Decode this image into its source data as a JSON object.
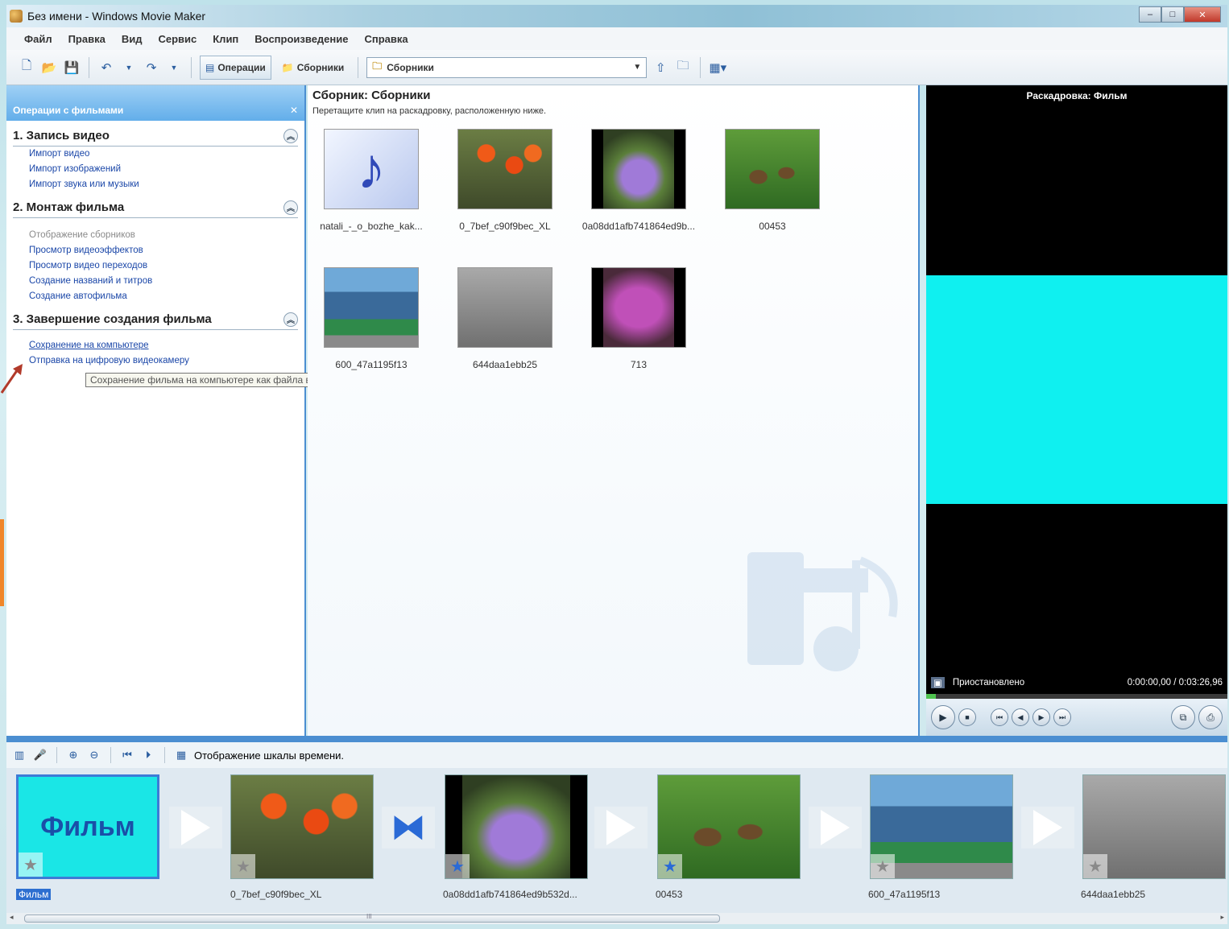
{
  "window": {
    "title": "Без имени - Windows Movie Maker"
  },
  "menu": [
    "Файл",
    "Правка",
    "Вид",
    "Сервис",
    "Клип",
    "Воспроизведение",
    "Справка"
  ],
  "toolbar": {
    "operations_label": "Операции",
    "collections_label": "Сборники",
    "collections_select": "Сборники"
  },
  "tasks": {
    "header": "Операции с фильмами",
    "sections": [
      {
        "title": "1. Запись видео",
        "links": [
          "Импорт видео",
          "Импорт изображений",
          "Импорт звука или музыки"
        ]
      },
      {
        "title": "2. Монтаж фильма",
        "links": [
          "Отображение сборников",
          "Просмотр видеоэффектов",
          "Просмотр видео переходов",
          "Создание названий и титров",
          "Создание автофильма"
        ]
      },
      {
        "title": "3. Завершение создания фильма",
        "links": [
          "Сохранение на компьютере",
          "Отправка на цифровую видеокамеру"
        ]
      }
    ],
    "tooltip": "Сохранение фильма на компьютере как файла видео."
  },
  "collection": {
    "title": "Сборник: Сборники",
    "hint": "Перетащите клип на раскадровку, расположенную ниже.",
    "clips": [
      "natali_-_o_bozhe_kak...",
      "0_7bef_c90f9bec_XL",
      "0a08dd1afb741864ed9b...",
      "00453",
      "600_47a1195f13",
      "644daa1ebb25",
      "713"
    ]
  },
  "monitor": {
    "title": "Раскадровка: Фильм",
    "status": "Приостановлено",
    "time": "0:00:00,00 / 0:03:26,96",
    "screen_color": "#0ff0f0"
  },
  "storyboard": {
    "toolbar_label": "Отображение шкалы времени.",
    "title_card": "Фильм",
    "labels": [
      "Фильм",
      "0_7bef_c90f9bec_XL",
      "0a08dd1afb741864ed9b532d...",
      "00453",
      "600_47a1195f13",
      "644daa1ebb25"
    ]
  },
  "scroll": {
    "mark": "III"
  }
}
